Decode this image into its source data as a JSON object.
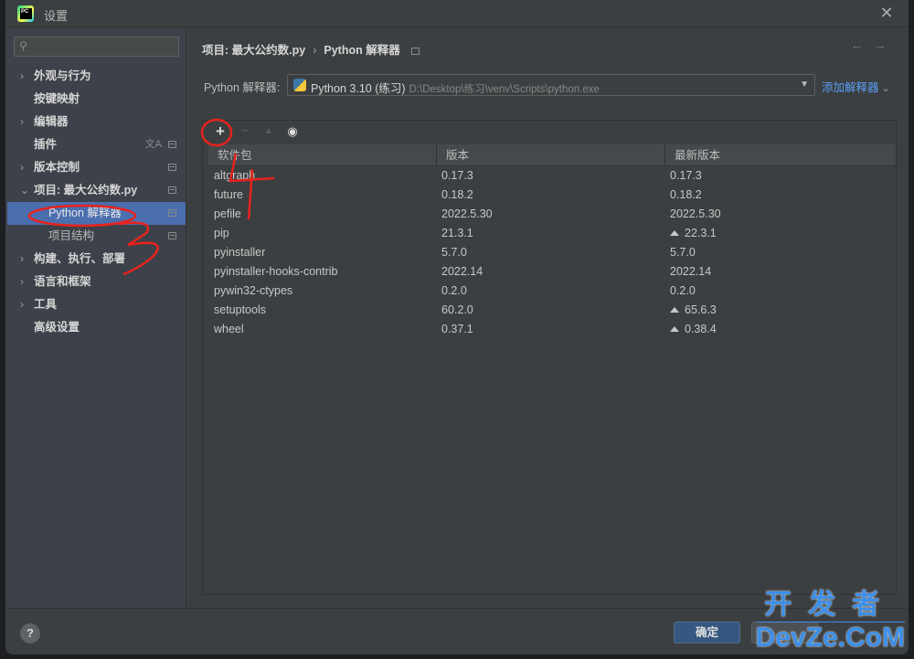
{
  "window": {
    "title": "设置",
    "close_icon": "close-icon"
  },
  "sidebar": {
    "search_placeholder": "",
    "items": [
      {
        "label": "外观与行为",
        "expandable": true,
        "expanded": false
      },
      {
        "label": "按键映射",
        "expandable": false
      },
      {
        "label": "编辑器",
        "expandable": true,
        "expanded": false
      },
      {
        "label": "插件",
        "expandable": false,
        "icons": [
          "translate-icon",
          "settings-badge-icon"
        ]
      },
      {
        "label": "版本控制",
        "expandable": true,
        "expanded": false,
        "icons": [
          "settings-badge-icon"
        ]
      },
      {
        "label": "项目: 最大公约数.py",
        "expandable": true,
        "expanded": true,
        "icons": [
          "settings-badge-icon"
        ]
      },
      {
        "label": "Python 解释器",
        "sub": true,
        "selected": true,
        "icons": [
          "settings-badge-icon"
        ]
      },
      {
        "label": "项目结构",
        "sub": true,
        "icons": [
          "settings-badge-icon"
        ]
      },
      {
        "label": "构建、执行、部署",
        "expandable": true,
        "expanded": false
      },
      {
        "label": "语言和框架",
        "expandable": true,
        "expanded": false
      },
      {
        "label": "工具",
        "expandable": true,
        "expanded": false
      },
      {
        "label": "高级设置",
        "expandable": false
      }
    ]
  },
  "breadcrumb": {
    "project": "项目: 最大公约数.py",
    "separator": "›",
    "page": "Python 解释器"
  },
  "interpreter": {
    "label": "Python 解释器:",
    "selected_name": "Python 3.10 (练习)",
    "selected_path": "D:\\Desktop\\练习\\venv\\Scripts\\python.exe",
    "add_label": "添加解释器"
  },
  "toolbar": {
    "add": "+",
    "remove": "−",
    "upgrade": "▲",
    "show": "👁"
  },
  "packages": {
    "columns": [
      "软件包",
      "版本",
      "最新版本"
    ],
    "rows": [
      {
        "name": "altgraph",
        "version": "0.17.3",
        "latest": "0.17.3",
        "upgrade": false
      },
      {
        "name": "future",
        "version": "0.18.2",
        "latest": "0.18.2",
        "upgrade": false
      },
      {
        "name": "pefile",
        "version": "2022.5.30",
        "latest": "2022.5.30",
        "upgrade": false
      },
      {
        "name": "pip",
        "version": "21.3.1",
        "latest": "22.3.1",
        "upgrade": true
      },
      {
        "name": "pyinstaller",
        "version": "5.7.0",
        "latest": "5.7.0",
        "upgrade": false
      },
      {
        "name": "pyinstaller-hooks-contrib",
        "version": "2022.14",
        "latest": "2022.14",
        "upgrade": false
      },
      {
        "name": "pywin32-ctypes",
        "version": "0.2.0",
        "latest": "0.2.0",
        "upgrade": false
      },
      {
        "name": "setuptools",
        "version": "60.2.0",
        "latest": "65.6.3",
        "upgrade": true
      },
      {
        "name": "wheel",
        "version": "0.37.1",
        "latest": "0.38.4",
        "upgrade": true
      }
    ]
  },
  "footer": {
    "help": "?",
    "ok_label": "确定",
    "cancel_label": ""
  },
  "annotations": {
    "color": "#e8231c",
    "marks": [
      "3",
      "4"
    ]
  },
  "watermark": {
    "line1": "开发者",
    "line2": "DevZe.CoM"
  }
}
